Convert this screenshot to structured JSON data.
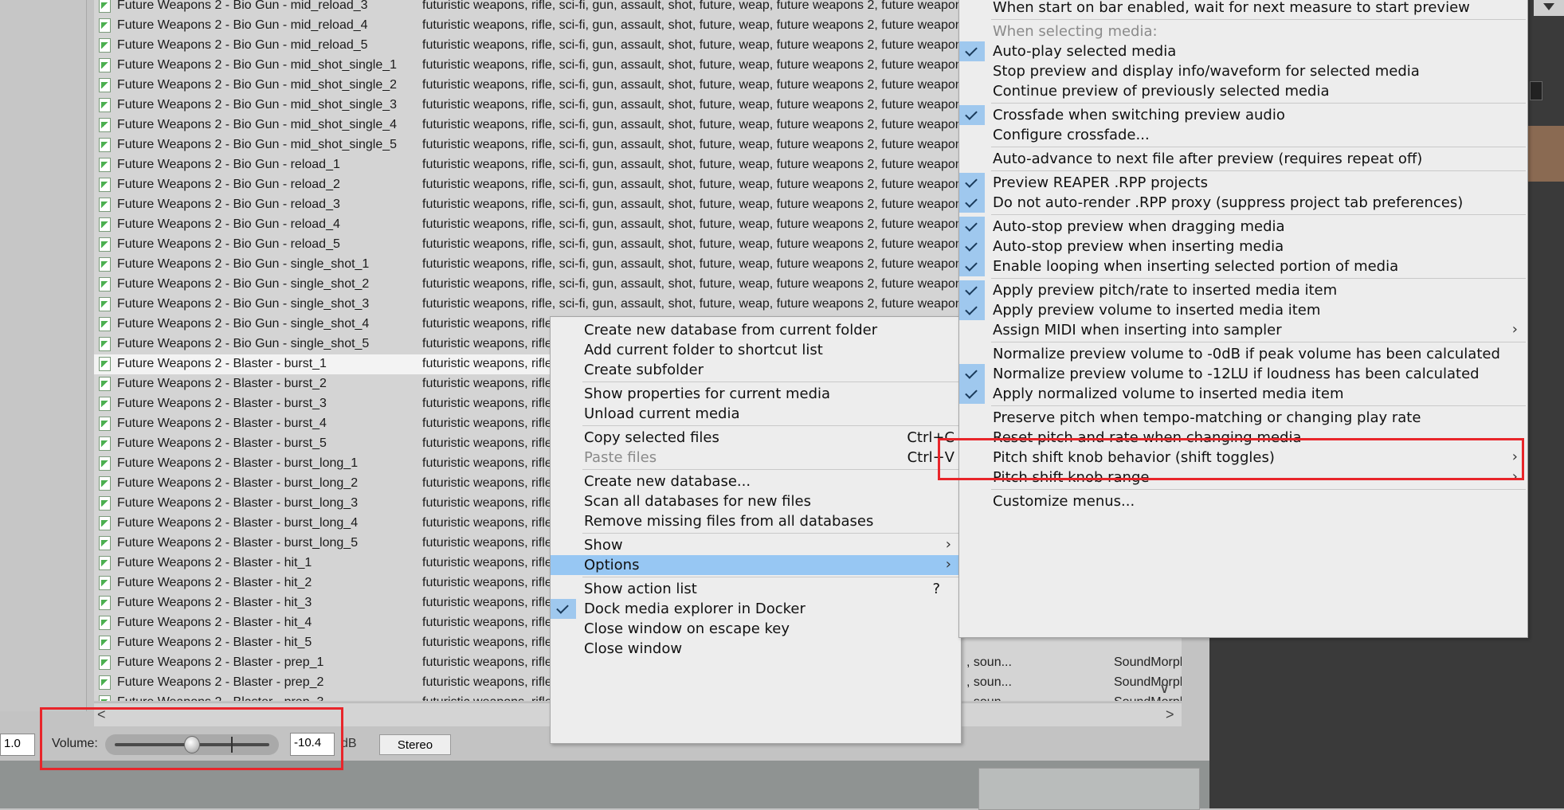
{
  "file_rows": [
    {
      "name": "Future Weapons 2 - Bio Gun - mid_reload_3",
      "tags": "futuristic weapons, rifle, sci-fi, gun, assault, shot, future, weap, future weapons 2, future weapon"
    },
    {
      "name": "Future Weapons 2 - Bio Gun - mid_reload_4",
      "tags": "futuristic weapons, rifle, sci-fi, gun, assault, shot, future, weap, future weapons 2, future weapon"
    },
    {
      "name": "Future Weapons 2 - Bio Gun - mid_reload_5",
      "tags": "futuristic weapons, rifle, sci-fi, gun, assault, shot, future, weap, future weapons 2, future weapon"
    },
    {
      "name": "Future Weapons 2 - Bio Gun - mid_shot_single_1",
      "tags": "futuristic weapons, rifle, sci-fi, gun, assault, shot, future, weap, future weapons 2, future weapon"
    },
    {
      "name": "Future Weapons 2 - Bio Gun - mid_shot_single_2",
      "tags": "futuristic weapons, rifle, sci-fi, gun, assault, shot, future, weap, future weapons 2, future weapon"
    },
    {
      "name": "Future Weapons 2 - Bio Gun - mid_shot_single_3",
      "tags": "futuristic weapons, rifle, sci-fi, gun, assault, shot, future, weap, future weapons 2, future weapon"
    },
    {
      "name": "Future Weapons 2 - Bio Gun - mid_shot_single_4",
      "tags": "futuristic weapons, rifle, sci-fi, gun, assault, shot, future, weap, future weapons 2, future weapon"
    },
    {
      "name": "Future Weapons 2 - Bio Gun - mid_shot_single_5",
      "tags": "futuristic weapons, rifle, sci-fi, gun, assault, shot, future, weap, future weapons 2, future weapon"
    },
    {
      "name": "Future Weapons 2 - Bio Gun - reload_1",
      "tags": "futuristic weapons, rifle, sci-fi, gun, assault, shot, future, weap, future weapons 2, future weapon"
    },
    {
      "name": "Future Weapons 2 - Bio Gun - reload_2",
      "tags": "futuristic weapons, rifle, sci-fi, gun, assault, shot, future, weap, future weapons 2, future weapon"
    },
    {
      "name": "Future Weapons 2 - Bio Gun - reload_3",
      "tags": "futuristic weapons, rifle, sci-fi, gun, assault, shot, future, weap, future weapons 2, future weapon"
    },
    {
      "name": "Future Weapons 2 - Bio Gun - reload_4",
      "tags": "futuristic weapons, rifle, sci-fi, gun, assault, shot, future, weap, future weapons 2, future weapon"
    },
    {
      "name": "Future Weapons 2 - Bio Gun - reload_5",
      "tags": "futuristic weapons, rifle, sci-fi, gun, assault, shot, future, weap, future weapons 2, future weapon"
    },
    {
      "name": "Future Weapons 2 - Bio Gun - single_shot_1",
      "tags": "futuristic weapons, rifle, sci-fi, gun, assault, shot, future, weap, future weapons 2, future weapon"
    },
    {
      "name": "Future Weapons 2 - Bio Gun - single_shot_2",
      "tags": "futuristic weapons, rifle, sci-fi, gun, assault, shot, future, weap, future weapons 2, future weapon"
    },
    {
      "name": "Future Weapons 2 - Bio Gun - single_shot_3",
      "tags": "futuristic weapons, rifle, sci-fi, gun, assault, shot, future, weap, future weapons 2, future weapon"
    },
    {
      "name": "Future Weapons 2 - Bio Gun - single_shot_4",
      "tags": "futuristic weapons, rifle"
    },
    {
      "name": "Future Weapons 2 - Bio Gun - single_shot_5",
      "tags": "futuristic weapons, rifle"
    },
    {
      "name": "Future Weapons 2 - Blaster - burst_1",
      "tags": "futuristic weapons, rifle",
      "selected": true
    },
    {
      "name": "Future Weapons 2 - Blaster - burst_2",
      "tags": "futuristic weapons, rifle"
    },
    {
      "name": "Future Weapons 2 - Blaster - burst_3",
      "tags": "futuristic weapons, rifle"
    },
    {
      "name": "Future Weapons 2 - Blaster - burst_4",
      "tags": "futuristic weapons, rifle"
    },
    {
      "name": "Future Weapons 2 - Blaster - burst_5",
      "tags": "futuristic weapons, rifle"
    },
    {
      "name": "Future Weapons 2 - Blaster - burst_long_1",
      "tags": "futuristic weapons, rifle"
    },
    {
      "name": "Future Weapons 2 - Blaster - burst_long_2",
      "tags": "futuristic weapons, rifle"
    },
    {
      "name": "Future Weapons 2 - Blaster - burst_long_3",
      "tags": "futuristic weapons, rifle"
    },
    {
      "name": "Future Weapons 2 - Blaster - burst_long_4",
      "tags": "futuristic weapons, rifle"
    },
    {
      "name": "Future Weapons 2 - Blaster - burst_long_5",
      "tags": "futuristic weapons, rifle"
    },
    {
      "name": "Future Weapons 2 - Blaster - hit_1",
      "tags": "futuristic weapons, rifle"
    },
    {
      "name": "Future Weapons 2 - Blaster - hit_2",
      "tags": "futuristic weapons, rifle"
    },
    {
      "name": "Future Weapons 2 - Blaster - hit_3",
      "tags": "futuristic weapons, rifle"
    },
    {
      "name": "Future Weapons 2 - Blaster - hit_4",
      "tags": "futuristic weapons, rifle"
    },
    {
      "name": "Future Weapons 2 - Blaster - hit_5",
      "tags": "futuristic weapons, rifle"
    },
    {
      "name": "Future Weapons 2 - Blaster - prep_1",
      "tags": "futuristic weapons, rifle",
      "col": ", soun...",
      "vendor": "SoundMorph"
    },
    {
      "name": "Future Weapons 2 - Blaster - prep_2",
      "tags": "futuristic weapons, rifle",
      "col": ", soun...",
      "vendor": "SoundMorph"
    },
    {
      "name": "Future Weapons 2 - Blaster - prep_3",
      "tags": "futuristic weapons, rifle",
      "col": ", soun...",
      "vendor": "SoundMorph"
    }
  ],
  "vendor_rows": [
    {
      "col": ", soun...",
      "vendor": "SoundMorph"
    }
  ],
  "volume": {
    "left_value": "1.0",
    "label": "Volume:",
    "value": "-10.4",
    "unit": "dB",
    "slider_level": 0.5,
    "stereo_label": "Stereo"
  },
  "context_menu": {
    "items": [
      {
        "label": "Create new database from current folder"
      },
      {
        "label": "Add current folder to shortcut list"
      },
      {
        "label": "Create subfolder"
      },
      {
        "sep": true
      },
      {
        "label": "Show properties for current media"
      },
      {
        "label": "Unload current media"
      },
      {
        "sep": true
      },
      {
        "label": "Copy selected files",
        "shortcut": "Ctrl+C"
      },
      {
        "label": "Paste files",
        "shortcut": "Ctrl+V",
        "disabled": true
      },
      {
        "sep": true
      },
      {
        "label": "Create new database..."
      },
      {
        "label": "Scan all databases for new files"
      },
      {
        "label": "Remove missing files from all databases"
      },
      {
        "sep": true
      },
      {
        "label": "Show",
        "submenu": true
      },
      {
        "label": "Options",
        "submenu": true,
        "active": true
      },
      {
        "sep": true
      },
      {
        "label": "Show action list",
        "shortcut": "?"
      },
      {
        "label": "Dock media explorer in Docker",
        "checked": true
      },
      {
        "label": "Close window on escape key"
      },
      {
        "label": "Close window"
      }
    ]
  },
  "options_menu": {
    "items": [
      {
        "label": "When start on bar enabled, wait for next measure to start preview"
      },
      {
        "sep": true
      },
      {
        "label": "When selecting media:",
        "disabled": true
      },
      {
        "label": "Auto-play selected media",
        "checked": true
      },
      {
        "label": "Stop preview and display info/waveform for selected media"
      },
      {
        "label": "Continue preview of previously selected media"
      },
      {
        "sep": true
      },
      {
        "label": "Crossfade when switching preview audio",
        "checked": true
      },
      {
        "label": "Configure crossfade..."
      },
      {
        "sep": true
      },
      {
        "label": "Auto-advance to next file after preview (requires repeat off)"
      },
      {
        "sep": true
      },
      {
        "label": "Preview REAPER .RPP projects",
        "checked": true
      },
      {
        "label": "Do not auto-render .RPP proxy (suppress project tab preferences)",
        "checked": true
      },
      {
        "sep": true
      },
      {
        "label": "Auto-stop preview when dragging media",
        "checked": true
      },
      {
        "label": "Auto-stop preview when inserting media",
        "checked": true
      },
      {
        "label": "Enable looping when inserting selected portion of media",
        "checked": true
      },
      {
        "sep": true
      },
      {
        "label": "Apply preview pitch/rate to inserted media item",
        "checked": true
      },
      {
        "label": "Apply preview volume to inserted media item",
        "checked": true
      },
      {
        "label": "Assign MIDI when inserting into sampler",
        "submenu": true
      },
      {
        "sep": true
      },
      {
        "label": "Normalize preview volume to -0dB if peak volume has been calculated"
      },
      {
        "label": "Normalize preview volume to -12LU if loudness has been calculated",
        "checked": true
      },
      {
        "label": "Apply normalized volume to inserted media item",
        "checked": true
      },
      {
        "sep": true
      },
      {
        "label": "Preserve pitch when tempo-matching or changing play rate"
      },
      {
        "label": "Reset pitch and rate when changing media"
      },
      {
        "label": "Pitch shift knob behavior (shift toggles)",
        "submenu": true
      },
      {
        "label": "Pitch shift knob range",
        "submenu": true
      },
      {
        "sep": true
      },
      {
        "label": "Customize menus..."
      }
    ]
  },
  "scroll": {
    "left": "<",
    "right": ">",
    "down": "∨"
  },
  "colors": {
    "highlight": "#e8252a",
    "menu_active": "#97c7f3",
    "check_bg": "#9fc8ee"
  }
}
